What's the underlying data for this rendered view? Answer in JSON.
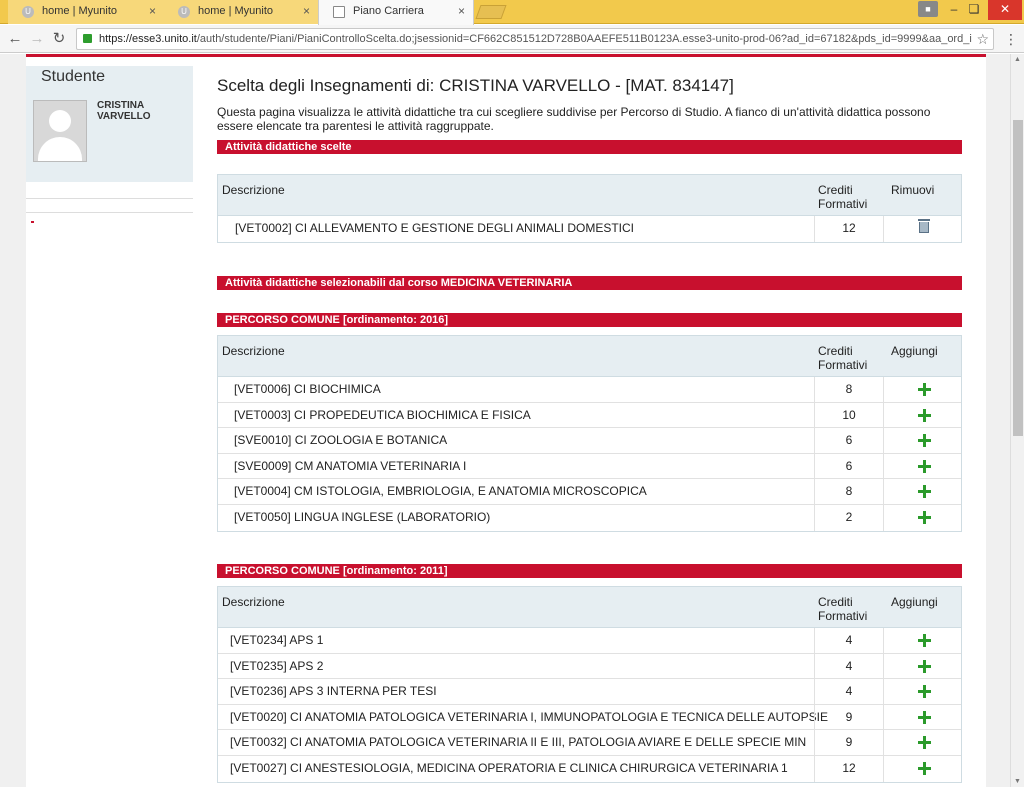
{
  "browser": {
    "tabs": [
      {
        "label": "home | Myunito",
        "icon_letter": "U"
      },
      {
        "label": "home | Myunito",
        "icon_letter": "U"
      },
      {
        "label": "Piano Carriera"
      }
    ],
    "close_glyph": "×",
    "url_host": "https://esse3.unito.it",
    "url_path": "/auth/studente/Piani/PianiControlloScelta.do;jsessionid=CF662C851512D728B0AAEFE511B0123A.esse3-unito-prod-06?ad_id=67182&pds_id=9999&aa_ord_i"
  },
  "sidebar": {
    "title": "Studente",
    "student_name": "CRISTINA VARVELLO"
  },
  "main": {
    "title": "Scelta degli Insegnamenti di: CRISTINA VARVELLO - [MAT. 834147]",
    "intro": "Questa pagina visualizza le attività didattiche tra cui scegliere suddivise per Percorso di Studio. A fianco di un'attività didattica possono essere elencate tra parentesi le attività raggruppate.",
    "chosen": {
      "header": "Attività didattiche scelte",
      "col_desc": "Descrizione",
      "col_credits": "Crediti Formativi",
      "col_action": "Rimuovi",
      "rows": [
        {
          "desc": "[VET0002] CI ALLEVAMENTO E GESTIONE DEGLI ANIMALI DOMESTICI",
          "credits": "12"
        }
      ]
    },
    "selectable_header": "Attività didattiche selezionabili dal corso MEDICINA VETERINARIA",
    "group2016": {
      "header": "PERCORSO COMUNE [ordinamento: 2016]",
      "col_desc": "Descrizione",
      "col_credits": "Crediti Formativi",
      "col_action": "Aggiungi",
      "rows": [
        {
          "desc": "[VET0006] CI BIOCHIMICA",
          "credits": "8"
        },
        {
          "desc": "[VET0003] CI PROPEDEUTICA BIOCHIMICA E FISICA",
          "credits": "10"
        },
        {
          "desc": "[SVE0010] CI ZOOLOGIA E BOTANICA",
          "credits": "6"
        },
        {
          "desc": "[SVE0009] CM ANATOMIA VETERINARIA I",
          "credits": "6"
        },
        {
          "desc": "[VET0004] CM ISTOLOGIA, EMBRIOLOGIA, E ANATOMIA MICROSCOPICA",
          "credits": "8"
        },
        {
          "desc": "[VET0050] LINGUA INGLESE (LABORATORIO)",
          "credits": "2"
        }
      ]
    },
    "group2011": {
      "header": "PERCORSO COMUNE [ordinamento: 2011]",
      "col_desc": "Descrizione",
      "col_credits": "Crediti Formativi",
      "col_action": "Aggiungi",
      "rows": [
        {
          "desc": "[VET0234] APS 1",
          "credits": "4"
        },
        {
          "desc": "[VET0235] APS 2",
          "credits": "4"
        },
        {
          "desc": "[VET0236] APS 3 INTERNA PER TESI",
          "credits": "4"
        },
        {
          "desc": "[VET0020] CI ANATOMIA PATOLOGICA VETERINARIA I, IMMUNOPATOLOGIA E TECNICA DELLE AUTOPSIE",
          "credits": "9"
        },
        {
          "desc": "[VET0032] CI ANATOMIA PATOLOGICA VETERINARIA II E III, PATOLOGIA AVIARE E DELLE SPECIE MIN",
          "credits": "9"
        },
        {
          "desc": "[VET0027] CI ANESTESIOLOGIA, MEDICINA OPERATORIA E CLINICA CHIRURGICA VETERINARIA 1",
          "credits": "12"
        }
      ]
    }
  },
  "colors": {
    "accent": "#c8102e",
    "table_header": "#e6eef2",
    "add_icon": "#2b9a2b",
    "tabbar": "#f2c94c"
  }
}
